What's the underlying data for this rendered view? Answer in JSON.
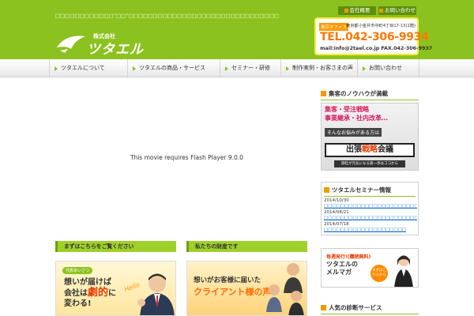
{
  "header": {
    "tagline": "□□□□□□□□□□□□“□□”□□□□□□□□□□□□□□□□□□□□□□□□□□□□□□□",
    "logo_sub": "株式会社",
    "logo_main": "ツタエル",
    "top_buttons": [
      "会社概要",
      "お問い合わせ"
    ],
    "contact": {
      "label": "東京オフィス",
      "address": "東京都小金井市中町4丁目17-13(2階)",
      "tel": "TEL.042-306-9934",
      "mail": "mail:info@2tael.co.jp FAX.042-306-9937"
    }
  },
  "nav": {
    "items": [
      "ツタエルについて",
      "ツタエルの商品・サービス",
      "セミナー・研修",
      "制作実例・お客さまの声",
      "お問い合わせ"
    ]
  },
  "main": {
    "flash_message": "This movie requires Flash Player 9.0.0",
    "section1_title": "まずはこちらをご覧ください",
    "section2_title": "私たちの財産です",
    "banner1": {
      "badge": "代表あいさつ",
      "line1": "想いが届けば",
      "line2a": "会社は",
      "line2b": "劇的",
      "line2c": "に",
      "line3": "変わる!",
      "hello": "Hello"
    },
    "banner2": {
      "line1": "想いがお客様に届いた",
      "line2": "クライアント様の声"
    }
  },
  "sidebar": {
    "knowhow_title": "集客のノウハウが満載",
    "knowhow_banner": {
      "line1": "集客・受注戦略",
      "line2": "事業継承・社内改革…",
      "line3": "そんなお悩みがある方は",
      "title_a": "出張",
      "title_b": "戦略",
      "title_c": "会議",
      "foot": "御社が元気になる第一歩はココから"
    },
    "seminar_title": "ツタエルセミナー情報",
    "seminar_items": [
      {
        "date": "2014/10/30",
        "link": "□□□□□□□□□□□□□□□□□□□□□□□□□□□□□"
      },
      {
        "date": "2014/08/21",
        "link": "□□□□□□□□□□□□□□□□□□□□□□□□"
      },
      {
        "date": "2014/07/18",
        "link": "□□□□□□□□□□□□□□□□□□□□"
      }
    ],
    "mail_banner": {
      "tag": "毎週発行!(購読無料)",
      "title1": "ツタエルの",
      "title2": "メルマガ",
      "btn": "まずはこちらから"
    },
    "popular_title": "人気の診断サービス"
  },
  "colors": {
    "brand_green": "#8cc21f",
    "accent_orange": "#f39a00",
    "tel_orange": "#ff7700",
    "link_blue": "#1a6fd0"
  }
}
